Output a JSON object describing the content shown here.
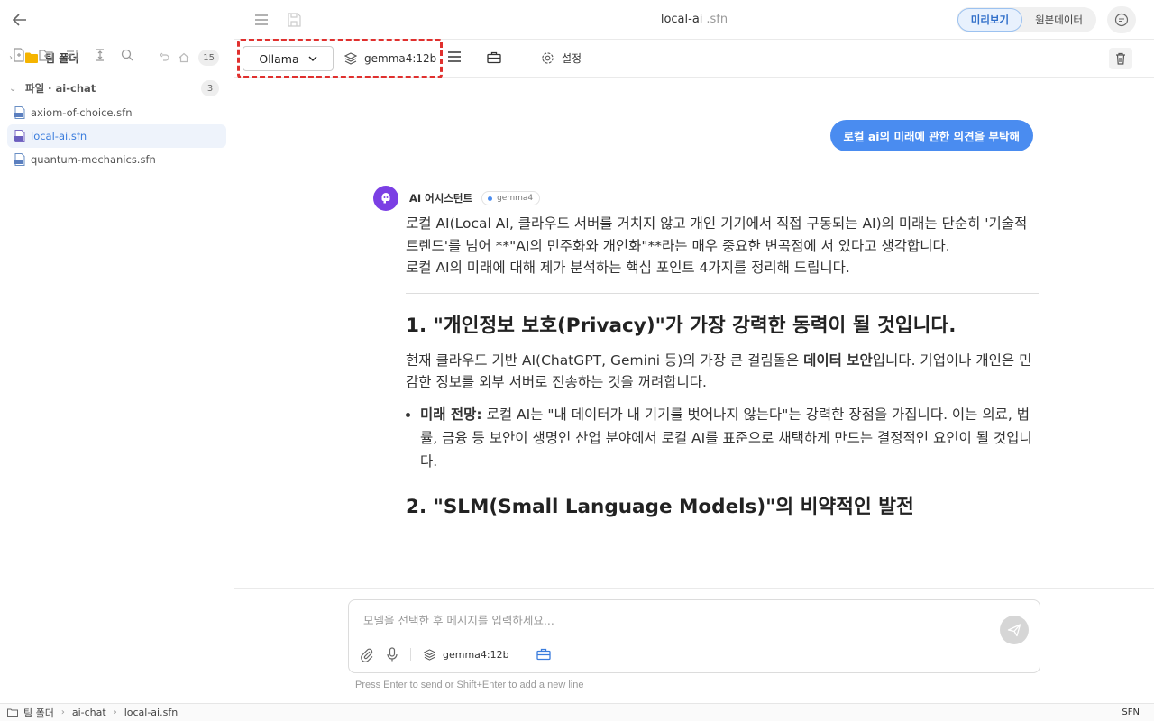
{
  "window": {
    "title": "local-ai",
    "ext": ".sfn"
  },
  "view_toggle": {
    "preview": "미리보기",
    "source": "원본데이터"
  },
  "sidebar": {
    "team_folder": {
      "label": "팀 폴더",
      "count": "15"
    },
    "section": {
      "label": "파일 · ai-chat",
      "count": "3"
    },
    "files": [
      {
        "name": "axiom-of-choice.sfn"
      },
      {
        "name": "local-ai.sfn"
      },
      {
        "name": "quantum-mechanics.sfn"
      }
    ]
  },
  "toolbar": {
    "provider": "Ollama",
    "model": "gemma4:12b",
    "settings_label": "설정"
  },
  "chat": {
    "user_message": "로컬 ai의 미래에 관한 의견을 부탁해",
    "assistant_name": "AI 어시스턴트",
    "assistant_model": "gemma4",
    "intro_line1": "로컬 AI(Local AI, 클라우드 서버를 거치지 않고 개인 기기에서 직접 구동되는 AI)의 미래는 단순히 '기술적 트렌드'를 넘어 **\"AI의 민주화와 개인화\"**라는 매우 중요한 변곡점에 서 있다고 생각합니다.",
    "intro_line2": "로컬 AI의 미래에 대해 제가 분석하는 핵심 포인트 4가지를 정리해 드립니다.",
    "h1": "1. \"개인정보 보호(Privacy)\"가 가장 강력한 동력이 될 것입니다.",
    "p1_before": "현재 클라우드 기반 AI(ChatGPT, Gemini 등)의 가장 큰 걸림돌은 ",
    "p1_bold": "데이터 보안",
    "p1_after": "입니다. 기업이나 개인은 민감한 정보를 외부 서버로 전송하는 것을 꺼려합니다.",
    "bullet_bold": "미래 전망:",
    "bullet_text": " 로컬 AI는 \"내 데이터가 내 기기를 벗어나지 않는다\"는 강력한 장점을 가집니다. 이는 의료, 법률, 금융 등 보안이 생명인 산업 분야에서 로컬 AI를 표준으로 채택하게 만드는 결정적인 요인이 될 것입니다.",
    "h2": "2. \"SLM(Small Language Models)\"의 비약적인 발전"
  },
  "composer": {
    "placeholder": "모델을 선택한 후 메시지를 입력하세요...",
    "model": "gemma4:12b",
    "hint": "Press Enter to send or Shift+Enter to add a new line"
  },
  "statusbar": {
    "crumbs": [
      "팀 폴더",
      "ai-chat",
      "local-ai.sfn"
    ],
    "format": "SFN"
  },
  "colors": {
    "accent": "#4a8cf0",
    "avatar": "#7b3fe4",
    "highlight": "#e0302e",
    "folder": "#f5b400"
  }
}
